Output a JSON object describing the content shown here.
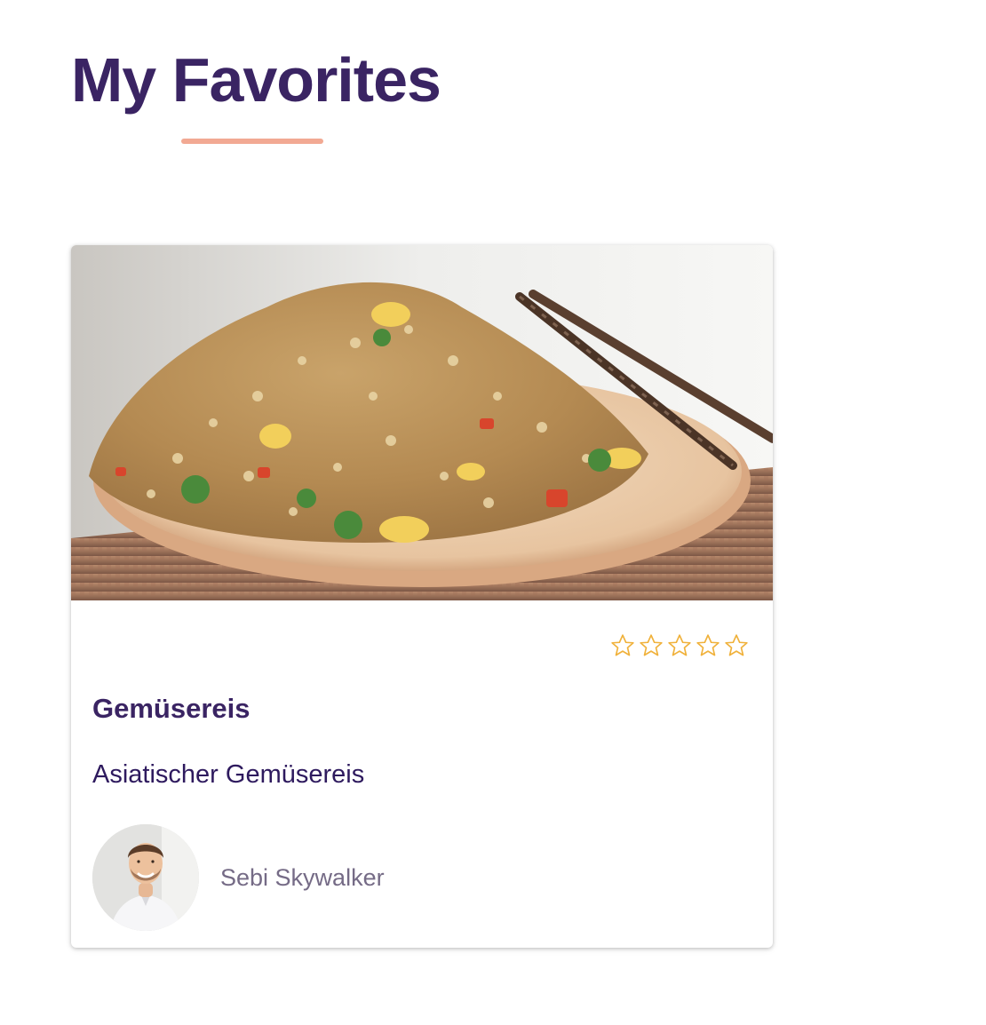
{
  "page": {
    "title": "My Favorites"
  },
  "colors": {
    "title": "#3a2463",
    "accent_underline": "#f2a993",
    "star_outline": "#f0b13a",
    "author_text": "#756b86"
  },
  "favorites": [
    {
      "image": "fried rice with vegetables on a plate with chopsticks",
      "rating": 0,
      "rating_max": 5,
      "title": "Gemüsereis",
      "description": "Asiatischer Gemüsereis",
      "author": {
        "name": "Sebi Skywalker",
        "avatar": "portrait of smiling man in white shirt"
      }
    }
  ]
}
